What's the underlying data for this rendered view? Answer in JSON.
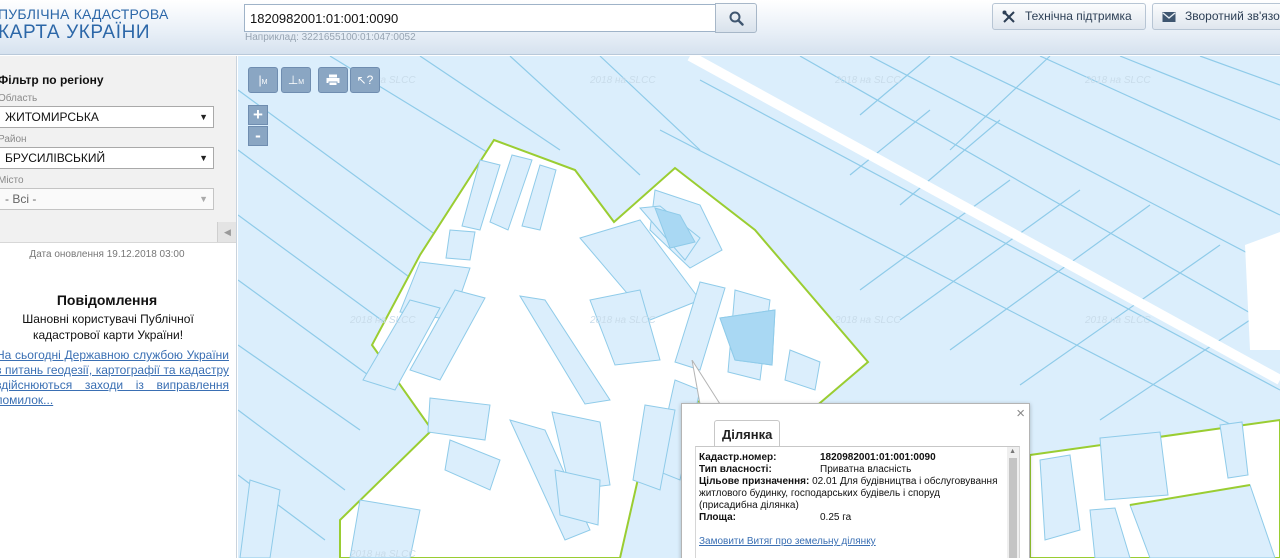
{
  "header": {
    "logo_line1": "ПУБЛІЧНА КАДАСТРОВА",
    "logo_line2": "КАРТА УКРАЇНИ",
    "search_value": "1820982001:01:001:0090",
    "search_hint": "Наприклад: 3221655100:01:047:0052",
    "support_label": "Технічна підтримка",
    "feedback_label": "Зворотний зв'язок"
  },
  "sidebar": {
    "filter_title": "Фільтр по регіону",
    "region_label": "Область",
    "region_value": "ЖИТОМИРСЬКА",
    "district_label": "Район",
    "district_value": "БРУСИЛІВСЬКИЙ",
    "city_label": "Місто",
    "city_value": "- Всі -",
    "update_text": "Дата оновлення  19.12.2018 03:00",
    "news_title": "Повідомлення",
    "news_body": "Шановні користувачі Публічної кадастрової карти України!",
    "news_link": "На сьогодні Державною службою України з питань геодезії, картографії та кадастру здійснюються заходи із виправлення помилок..."
  },
  "map": {
    "watermark": "2018 на SLCC",
    "zoom_in": "+",
    "zoom_out": "-",
    "colors": {
      "parcel_fill": "#dbeefc",
      "parcel_stroke": "#8fcbe9",
      "boundary": "#9acd32",
      "selected": "#a9d8f3"
    }
  },
  "popup": {
    "tab_label": "Ділянка",
    "close_label": "×",
    "cadastral_key": "Кадастр.номер:",
    "cadastral_value": "1820982001:01:001:0090",
    "ownership_key": "Тип власності:",
    "ownership_value": "Приватна власність",
    "purpose_key": "Цільове призначення:",
    "purpose_value": "02.01 Для будівництва і обслуговування житлового будинку, господарських будівель і споруд (присадибна ділянка)",
    "area_key": "Площа:",
    "area_value": "0.25 га",
    "order_link": "Замовити Витяг про земельну ділянку"
  }
}
